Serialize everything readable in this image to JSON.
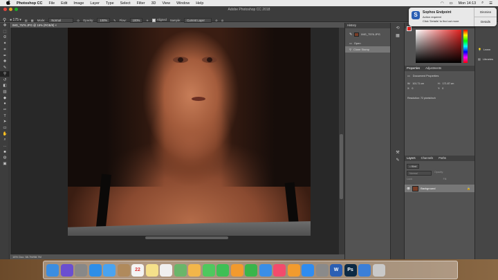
{
  "menubar": {
    "apple": "",
    "app": "Photoshop CC",
    "items": [
      "File",
      "Edit",
      "Image",
      "Layer",
      "Type",
      "Select",
      "Filter",
      "3D",
      "View",
      "Window",
      "Help"
    ],
    "clock": "Mon 14:13"
  },
  "window": {
    "title": "Adobe Photoshop CC 2018"
  },
  "options": {
    "mode_label": "Mode:",
    "mode": "Normal",
    "opacity_label": "Opacity:",
    "opacity": "100%",
    "flow_label": "Flow:",
    "flow": "100%",
    "aligned": "Aligned",
    "sample_label": "Sample:",
    "sample": "Current Layer"
  },
  "document": {
    "tab": "IMG_7576.JPG @ 16% (RGB/8)",
    "status": "16%     Doc: 58.7M/58.7M"
  },
  "history": {
    "title": "History",
    "snapshot": "IMG_7576.JPG",
    "items": [
      "Open",
      "Clone Stamp"
    ]
  },
  "notification": {
    "title": "Sophos Endpoint",
    "line1": "Action required",
    "line2": "Click 'Details' to find out more",
    "dismiss": "Dismiss",
    "details": "Details"
  },
  "right_icons": {
    "learn": "Learn",
    "libraries": "Libraries"
  },
  "properties": {
    "tabs": [
      "Properties",
      "Adjustments"
    ],
    "heading": "Document Properties",
    "w_label": "W:",
    "w": "101.71 cm",
    "h_label": "H:",
    "h": "171.87 cm",
    "x_label": "X:",
    "x": "0",
    "y_label": "Y:",
    "y": "0",
    "resolution": "Resolution: 72 pixels/inch"
  },
  "layers": {
    "tabs": [
      "Layers",
      "Channels",
      "Paths"
    ],
    "kind": "Kind",
    "mode": "Normal",
    "opacity_label": "Opacity:",
    "lock_label": "Lock:",
    "fill_label": "Fill:",
    "layer_name": "Background"
  },
  "tools": [
    "move",
    "marquee",
    "lasso",
    "quick-select",
    "crop",
    "eyedropper",
    "healing",
    "brush",
    "clone-stamp",
    "history-brush",
    "eraser",
    "gradient",
    "blur",
    "dodge",
    "pen",
    "type",
    "path-select",
    "rectangle",
    "hand",
    "zoom",
    "more",
    "fg-bg",
    "quick-mask",
    "screen-mode"
  ],
  "dock": [
    {
      "name": "finder",
      "color": "#3b8de0"
    },
    {
      "name": "siri",
      "color": "#6a4fd0"
    },
    {
      "name": "launchpad",
      "color": "#888"
    },
    {
      "name": "safari",
      "color": "#2e8ee8"
    },
    {
      "name": "mail",
      "color": "#4aa3ef"
    },
    {
      "name": "contacts",
      "color": "#b08a5c"
    },
    {
      "name": "calendar",
      "color": "#f4f4f4",
      "text": "22"
    },
    {
      "name": "notes",
      "color": "#f5e08a"
    },
    {
      "name": "reminders",
      "color": "#f0f0f0"
    },
    {
      "name": "maps",
      "color": "#6ab56a"
    },
    {
      "name": "photos",
      "color": "#f2b64a"
    },
    {
      "name": "messages",
      "color": "#4fc85e"
    },
    {
      "name": "facetime",
      "color": "#3fbf55"
    },
    {
      "name": "pages",
      "color": "#f29a2e"
    },
    {
      "name": "numbers",
      "color": "#39b54a"
    },
    {
      "name": "keynote",
      "color": "#3a8ee6"
    },
    {
      "name": "music",
      "color": "#f34b6c"
    },
    {
      "name": "books",
      "color": "#f29b2e"
    },
    {
      "name": "app-store",
      "color": "#2f8cf0"
    },
    {
      "name": "system-preferences",
      "color": "#8a8a8a"
    },
    {
      "name": "word",
      "color": "#2b5fb3",
      "text": "W"
    },
    {
      "name": "photoshop",
      "color": "#0c2a44",
      "text": "Ps"
    },
    {
      "name": "downloads",
      "color": "#3b7fd8"
    },
    {
      "name": "trash",
      "color": "#c9c9c9"
    }
  ]
}
